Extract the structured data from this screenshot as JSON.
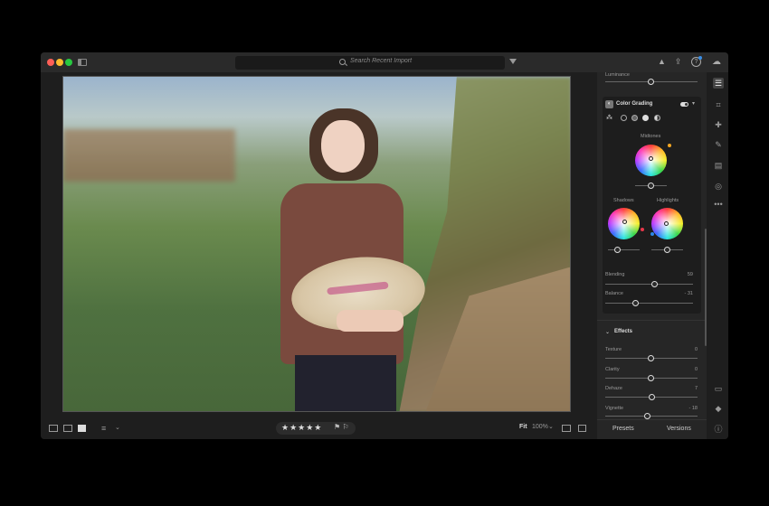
{
  "titlebar": {
    "search_placeholder": "Search Recent Import"
  },
  "panel": {
    "luminance_label": "Luminance",
    "color_grading": {
      "title": "Color Grading",
      "midtones_label": "Midtones",
      "shadows_label": "Shadows",
      "highlights_label": "Highlights",
      "blending_label": "Blending",
      "blending_value": "59",
      "balance_label": "Balance",
      "balance_value": "- 31"
    },
    "effects": {
      "title": "Effects",
      "items": [
        {
          "label": "Texture",
          "value": "0"
        },
        {
          "label": "Clarity",
          "value": "0"
        },
        {
          "label": "Dehaze",
          "value": "7"
        },
        {
          "label": "Vignette",
          "value": "- 18"
        }
      ]
    }
  },
  "tabs": {
    "presets": "Presets",
    "versions": "Versions"
  },
  "bottom_bar": {
    "stars": "★★★★★",
    "flags": "⚑ ⚐",
    "fit": "Fit",
    "zoom": "100%"
  },
  "icons": {
    "search": "search-icon",
    "filter": "filter-icon",
    "bell": "bell-icon",
    "share": "share-icon",
    "help": "help-icon",
    "cloud": "cloud-icon",
    "edit": "sliders-icon",
    "crop": "crop-icon",
    "heal": "healing-icon",
    "brush": "brush-icon",
    "gradient": "gradient-icon",
    "radial": "radial-icon",
    "more": "more-icon",
    "comment": "comment-icon",
    "tag": "tag-icon",
    "info": "info-icon"
  },
  "colors": {
    "accent": "#3a8ee6",
    "background": "#1e1e1e",
    "panel": "#262626"
  }
}
